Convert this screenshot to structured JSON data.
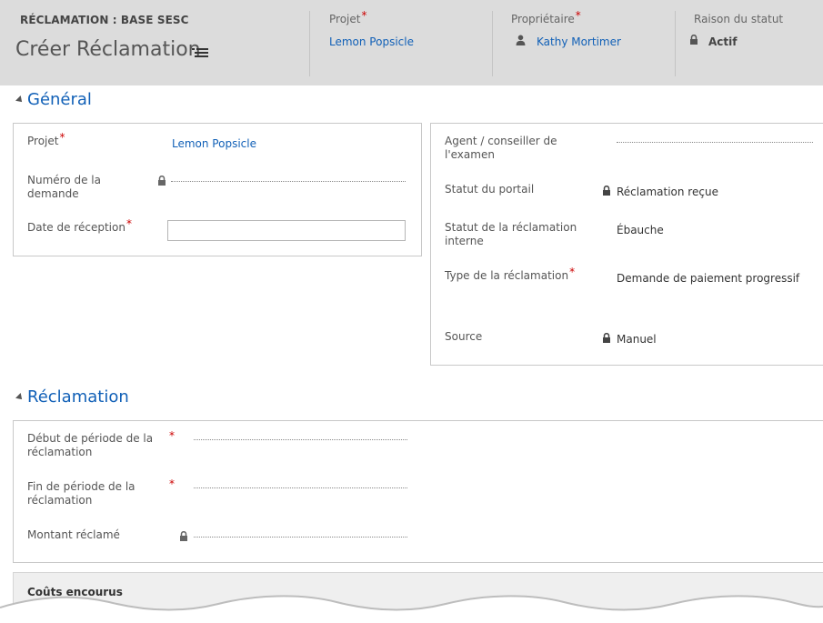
{
  "header": {
    "entity_type": "RÉCLAMATION : BASE SESC",
    "form_title": "Créer Réclamation",
    "fields": {
      "projet": {
        "label": "Projet",
        "value": "Lemon Popsicle"
      },
      "proprietaire": {
        "label": "Propriétaire",
        "value": "Kathy Mortimer"
      },
      "raison": {
        "label": "Raison du statut",
        "value": "Actif"
      }
    },
    "required_mark": "*"
  },
  "general": {
    "title": "Général",
    "left": {
      "projet_label": "Projet",
      "projet_value": "Lemon Popsicle",
      "numero_label": "Numéro de la demande",
      "date_label": "Date de réception"
    },
    "right": {
      "agent_label": "Agent / conseiller de l'examen",
      "statut_portail_label": "Statut du portail",
      "statut_portail_value": "Réclamation reçue",
      "statut_interne_label": "Statut de la réclamation interne",
      "statut_interne_value": "Ébauche",
      "type_label": "Type de la réclamation",
      "type_value": "Demande de paiement progressif",
      "source_label": "Source",
      "source_value": "Manuel"
    }
  },
  "reclamation": {
    "title": "Réclamation",
    "debut_label": "Début de période de la réclamation",
    "fin_label": "Fin de période de la réclamation",
    "montant_label": "Montant réclamé"
  },
  "couts": {
    "title": "Coûts encourus"
  },
  "colors": {
    "link": "#1160b7",
    "required": "#cc0000",
    "header_bg": "#dcdcdc"
  },
  "icons": [
    "hamburger-menu-icon",
    "person-icon",
    "lock-icon",
    "collapse-triangle-icon"
  ]
}
